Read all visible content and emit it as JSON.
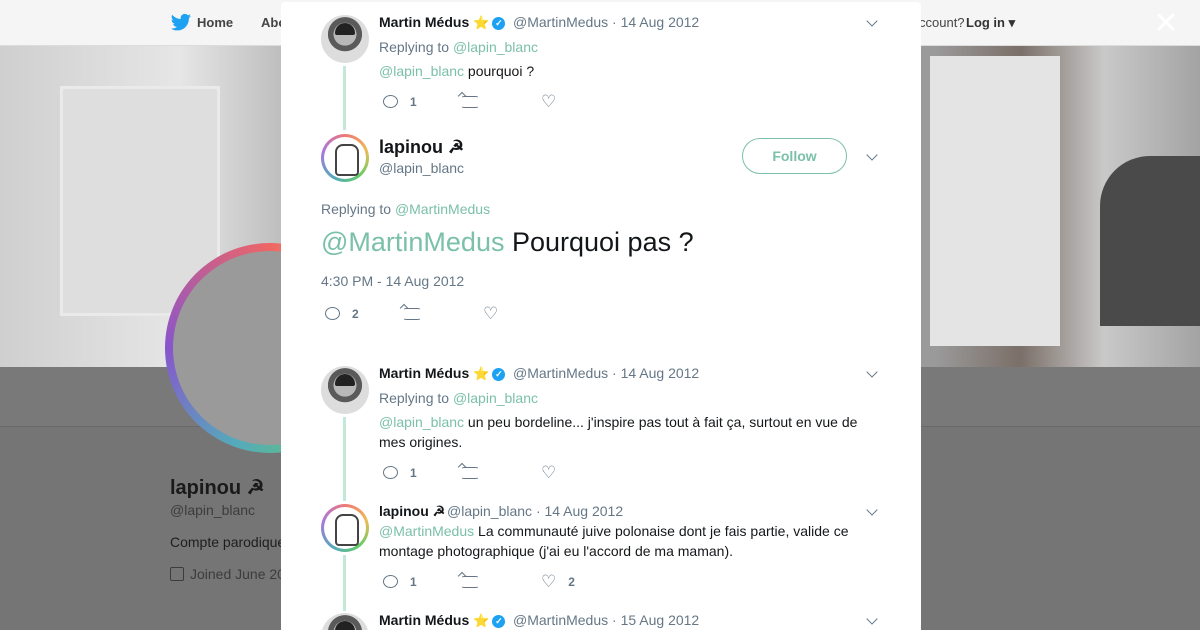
{
  "nav": {
    "home_label": "Home",
    "about_label": "Abo",
    "account_text": "ccount?",
    "login_label": "Log in"
  },
  "profile": {
    "name": "lapinou ☭",
    "handle": "@lapin_blanc",
    "bio": "Compte parodique",
    "joined": "Joined June 20"
  },
  "modal": {
    "tweets": [
      {
        "name": "Martin Médus",
        "badge": "⭐",
        "handle": "@MartinMedus",
        "date": "· 14 Aug 2012",
        "replying_label": "Replying to",
        "replying_to": "@lapin_blanc",
        "mention": "@lapin_blanc",
        "text": " pourquoi ?",
        "replies": "1",
        "retweets": "",
        "likes": ""
      }
    ],
    "main_tweet": {
      "name": "lapinou ☭",
      "handle": "@lapin_blanc",
      "follow_label": "Follow",
      "replying_label": "Replying to",
      "replying_to": "@MartinMedus",
      "mention": "@MartinMedus",
      "text": " Pourquoi pas ?",
      "time": "4:30 PM - 14 Aug 2012",
      "replies": "2",
      "retweets": "",
      "likes": ""
    },
    "replies": [
      {
        "name": "Martin Médus",
        "badge": "⭐",
        "handle": "@MartinMedus",
        "date": "· 14 Aug 2012",
        "replying_label": "Replying to",
        "replying_to": "@lapin_blanc",
        "mention": "@lapin_blanc",
        "text": " un peu bordeline... j'inspire pas tout à fait ça, surtout en vue de mes origines.",
        "replies": "1",
        "retweets": "",
        "likes": ""
      },
      {
        "name": "lapinou ☭",
        "handle": "@lapin_blanc",
        "date": "· 14 Aug 2012",
        "mention": "@MartinMedus",
        "text": " La communauté juive polonaise dont je fais partie, valide ce montage photographique (j'ai eu l'accord de ma maman).",
        "replies": "1",
        "retweets": "",
        "likes": "2"
      },
      {
        "name": "Martin Médus",
        "badge": "⭐",
        "handle": "@MartinMedus",
        "date": "· 15 Aug 2012"
      }
    ]
  },
  "colors": {
    "accent": "#7bc0a9",
    "text": "#14171a",
    "muted": "#657786",
    "overlay": "#757575"
  },
  "icons": [
    "twitter-bird-icon",
    "close-icon",
    "reply-icon",
    "retweet-icon",
    "like-icon",
    "chevron-down-icon",
    "verified-icon",
    "calendar-icon"
  ]
}
